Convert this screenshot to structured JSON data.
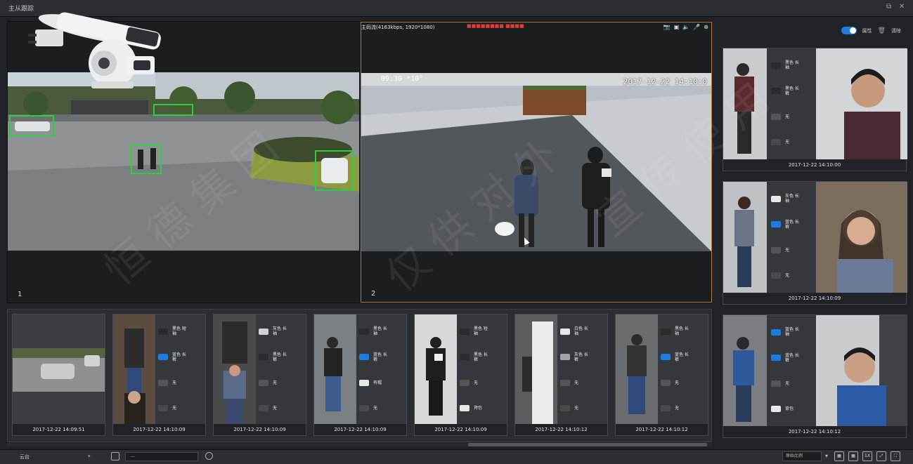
{
  "app": {
    "title": "主从跟踪"
  },
  "window_controls": {
    "restore": "⧉",
    "close": "✕"
  },
  "video": {
    "right_info": "主码流(4163kbps, 1920*1080)",
    "right_status": "■■■■■■■■  ■■■■",
    "left_overlay": "",
    "right_overlay_time": "2017-12-22 14:10:0",
    "left_top_text": "09:30  *10°",
    "left_index": "1",
    "right_index": "2",
    "tools": [
      "📷",
      "▣",
      "🔈",
      "🎤",
      "⊕"
    ]
  },
  "sidebar": {
    "toggle_label": "属性",
    "clear_label": "清除",
    "cards": [
      {
        "time": "2017-12-22 14:10:00",
        "attrs": [
          "黑色 长袖",
          "黑色 长裤",
          "无",
          "无"
        ]
      },
      {
        "time": "2017-12-22 14:10:09",
        "attrs": [
          "灰色 长袖",
          "蓝色 长裤",
          "无",
          "无"
        ]
      },
      {
        "time": "2017-12-22 14:10:12",
        "attrs": [
          "蓝色 长袖",
          "蓝色 长裤",
          "无",
          "背包"
        ]
      }
    ]
  },
  "thumbnails": [
    {
      "time": "2017-12-22 14:09:51",
      "attrs": []
    },
    {
      "time": "2017-12-22 14:10:09",
      "attrs": [
        "黑色 短袖",
        "蓝色 长裤",
        "无",
        "无"
      ]
    },
    {
      "time": "2017-12-22 14:10:09",
      "attrs": [
        "灰色 长袖",
        "黑色 长裤",
        "无",
        "无"
      ]
    },
    {
      "time": "2017-12-22 14:10:09",
      "attrs": [
        "黑色 长袖",
        "蓝色 长裤",
        "有帽",
        "无"
      ]
    },
    {
      "time": "2017-12-22 14:10:09",
      "attrs": [
        "黑色 短袖",
        "黑色 长裤",
        "无",
        "挎包"
      ]
    },
    {
      "time": "2017-12-22 14:10:12",
      "attrs": [
        "白色 长袖",
        "灰色 长裤",
        "无",
        "无"
      ]
    },
    {
      "time": "2017-12-22 14:10:12",
      "attrs": [
        "黑色 长袖",
        "蓝色 长裤",
        "无",
        "无"
      ]
    }
  ],
  "bottombar": {
    "label": "云台",
    "select_placeholder": "—",
    "layout_select": "原始比例",
    "btns": [
      "▦",
      "▦",
      "1X",
      "⤢",
      "⛶"
    ]
  },
  "colors": {
    "accent": "#1e7be0",
    "highlight": "#b9782d",
    "box": "#2ecc40"
  }
}
